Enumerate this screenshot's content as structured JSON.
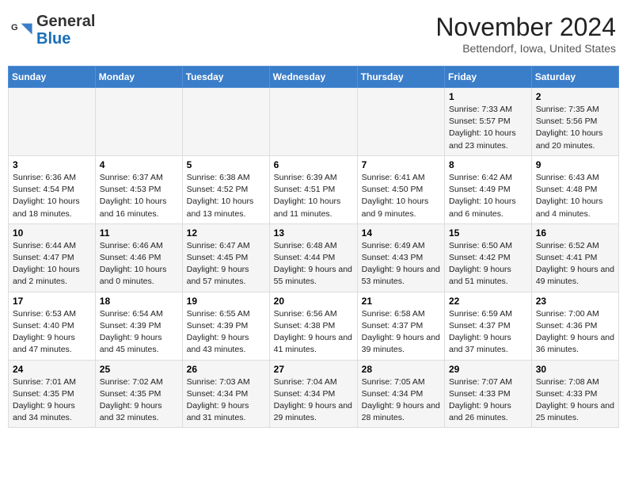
{
  "logo": {
    "general": "General",
    "blue": "Blue"
  },
  "title": "November 2024",
  "location": "Bettendorf, Iowa, United States",
  "days_of_week": [
    "Sunday",
    "Monday",
    "Tuesday",
    "Wednesday",
    "Thursday",
    "Friday",
    "Saturday"
  ],
  "weeks": [
    [
      {
        "day": "",
        "info": ""
      },
      {
        "day": "",
        "info": ""
      },
      {
        "day": "",
        "info": ""
      },
      {
        "day": "",
        "info": ""
      },
      {
        "day": "",
        "info": ""
      },
      {
        "day": "1",
        "info": "Sunrise: 7:33 AM\nSunset: 5:57 PM\nDaylight: 10 hours and 23 minutes."
      },
      {
        "day": "2",
        "info": "Sunrise: 7:35 AM\nSunset: 5:56 PM\nDaylight: 10 hours and 20 minutes."
      }
    ],
    [
      {
        "day": "3",
        "info": "Sunrise: 6:36 AM\nSunset: 4:54 PM\nDaylight: 10 hours and 18 minutes."
      },
      {
        "day": "4",
        "info": "Sunrise: 6:37 AM\nSunset: 4:53 PM\nDaylight: 10 hours and 16 minutes."
      },
      {
        "day": "5",
        "info": "Sunrise: 6:38 AM\nSunset: 4:52 PM\nDaylight: 10 hours and 13 minutes."
      },
      {
        "day": "6",
        "info": "Sunrise: 6:39 AM\nSunset: 4:51 PM\nDaylight: 10 hours and 11 minutes."
      },
      {
        "day": "7",
        "info": "Sunrise: 6:41 AM\nSunset: 4:50 PM\nDaylight: 10 hours and 9 minutes."
      },
      {
        "day": "8",
        "info": "Sunrise: 6:42 AM\nSunset: 4:49 PM\nDaylight: 10 hours and 6 minutes."
      },
      {
        "day": "9",
        "info": "Sunrise: 6:43 AM\nSunset: 4:48 PM\nDaylight: 10 hours and 4 minutes."
      }
    ],
    [
      {
        "day": "10",
        "info": "Sunrise: 6:44 AM\nSunset: 4:47 PM\nDaylight: 10 hours and 2 minutes."
      },
      {
        "day": "11",
        "info": "Sunrise: 6:46 AM\nSunset: 4:46 PM\nDaylight: 10 hours and 0 minutes."
      },
      {
        "day": "12",
        "info": "Sunrise: 6:47 AM\nSunset: 4:45 PM\nDaylight: 9 hours and 57 minutes."
      },
      {
        "day": "13",
        "info": "Sunrise: 6:48 AM\nSunset: 4:44 PM\nDaylight: 9 hours and 55 minutes."
      },
      {
        "day": "14",
        "info": "Sunrise: 6:49 AM\nSunset: 4:43 PM\nDaylight: 9 hours and 53 minutes."
      },
      {
        "day": "15",
        "info": "Sunrise: 6:50 AM\nSunset: 4:42 PM\nDaylight: 9 hours and 51 minutes."
      },
      {
        "day": "16",
        "info": "Sunrise: 6:52 AM\nSunset: 4:41 PM\nDaylight: 9 hours and 49 minutes."
      }
    ],
    [
      {
        "day": "17",
        "info": "Sunrise: 6:53 AM\nSunset: 4:40 PM\nDaylight: 9 hours and 47 minutes."
      },
      {
        "day": "18",
        "info": "Sunrise: 6:54 AM\nSunset: 4:39 PM\nDaylight: 9 hours and 45 minutes."
      },
      {
        "day": "19",
        "info": "Sunrise: 6:55 AM\nSunset: 4:39 PM\nDaylight: 9 hours and 43 minutes."
      },
      {
        "day": "20",
        "info": "Sunrise: 6:56 AM\nSunset: 4:38 PM\nDaylight: 9 hours and 41 minutes."
      },
      {
        "day": "21",
        "info": "Sunrise: 6:58 AM\nSunset: 4:37 PM\nDaylight: 9 hours and 39 minutes."
      },
      {
        "day": "22",
        "info": "Sunrise: 6:59 AM\nSunset: 4:37 PM\nDaylight: 9 hours and 37 minutes."
      },
      {
        "day": "23",
        "info": "Sunrise: 7:00 AM\nSunset: 4:36 PM\nDaylight: 9 hours and 36 minutes."
      }
    ],
    [
      {
        "day": "24",
        "info": "Sunrise: 7:01 AM\nSunset: 4:35 PM\nDaylight: 9 hours and 34 minutes."
      },
      {
        "day": "25",
        "info": "Sunrise: 7:02 AM\nSunset: 4:35 PM\nDaylight: 9 hours and 32 minutes."
      },
      {
        "day": "26",
        "info": "Sunrise: 7:03 AM\nSunset: 4:34 PM\nDaylight: 9 hours and 31 minutes."
      },
      {
        "day": "27",
        "info": "Sunrise: 7:04 AM\nSunset: 4:34 PM\nDaylight: 9 hours and 29 minutes."
      },
      {
        "day": "28",
        "info": "Sunrise: 7:05 AM\nSunset: 4:34 PM\nDaylight: 9 hours and 28 minutes."
      },
      {
        "day": "29",
        "info": "Sunrise: 7:07 AM\nSunset: 4:33 PM\nDaylight: 9 hours and 26 minutes."
      },
      {
        "day": "30",
        "info": "Sunrise: 7:08 AM\nSunset: 4:33 PM\nDaylight: 9 hours and 25 minutes."
      }
    ]
  ]
}
